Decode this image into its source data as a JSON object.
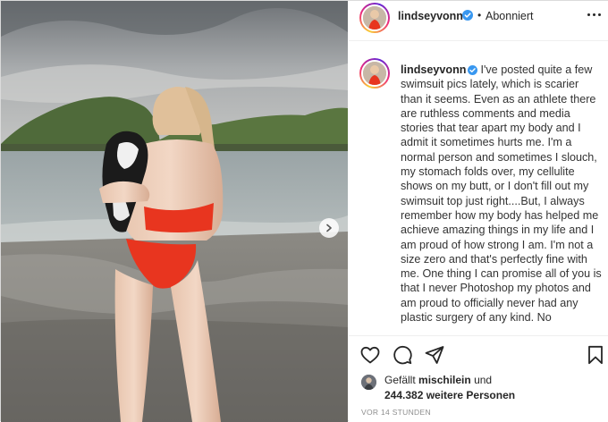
{
  "header": {
    "username": "lindseyvonn",
    "separator": "•",
    "follow_status": "Abonniert"
  },
  "caption": {
    "username": "lindseyvonn",
    "text": "I've posted quite a few swimsuit pics lately, which is scarier than it seems. Even as an athlete there are ruthless comments and media stories that tear apart my body and I admit it sometimes hurts me. I'm a normal person and sometimes I slouch, my stomach folds over, my cellulite shows on my butt, or I don't fill out my swimsuit top just right....But, I always remember how my body has helped me achieve amazing things in my life and I am proud of how strong I am.  I'm not a size zero and that's perfectly fine with me. One thing I can promise all of you is that I never Photoshop my photos and am proud to officially never had any plastic surgery of any kind. No"
  },
  "likes": {
    "prefix": "Gefällt",
    "liker": "mischilein",
    "conjunction": "und",
    "others_count": "244.382 weitere Personen"
  },
  "timestamp": "VOR 14 STUNDEN",
  "icons": {
    "verified": "verified-badge-icon",
    "more": "more-options-icon",
    "like": "heart-icon",
    "comment": "comment-icon",
    "share": "share-icon",
    "save": "bookmark-icon",
    "next": "chevron-right-icon"
  },
  "colors": {
    "verified_blue": "#3897f0",
    "text": "#262626",
    "muted": "#8e8e8e",
    "swimsuit_red": "#e8351f"
  }
}
